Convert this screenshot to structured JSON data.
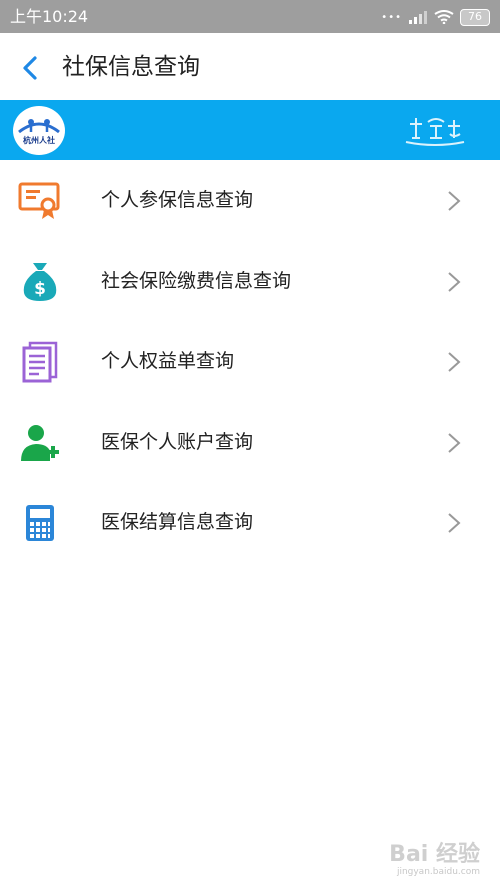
{
  "status_bar": {
    "time": "上午10:24",
    "battery": "76",
    "dots": "•••"
  },
  "header": {
    "title": "社保信息查询"
  },
  "banner": {
    "logo_text": "杭州人社"
  },
  "menu": {
    "items": [
      {
        "label": "个人参保信息查询",
        "icon": "certificate-icon",
        "color": "#f07a2e"
      },
      {
        "label": "社会保险缴费信息查询",
        "icon": "money-bag-icon",
        "color": "#19a9b8"
      },
      {
        "label": "个人权益单查询",
        "icon": "document-icon",
        "color": "#9b63d6"
      },
      {
        "label": "医保个人账户查询",
        "icon": "add-user-icon",
        "color": "#1aa64a"
      },
      {
        "label": "医保结算信息查询",
        "icon": "calculator-icon",
        "color": "#2b86d8"
      }
    ]
  },
  "watermark": {
    "main": "Bai 经验",
    "sub": "jingyan.baidu.com"
  },
  "colors": {
    "accent": "#0aa8ef",
    "back_arrow": "#1e88e5",
    "status_bar": "#9e9e9e"
  }
}
